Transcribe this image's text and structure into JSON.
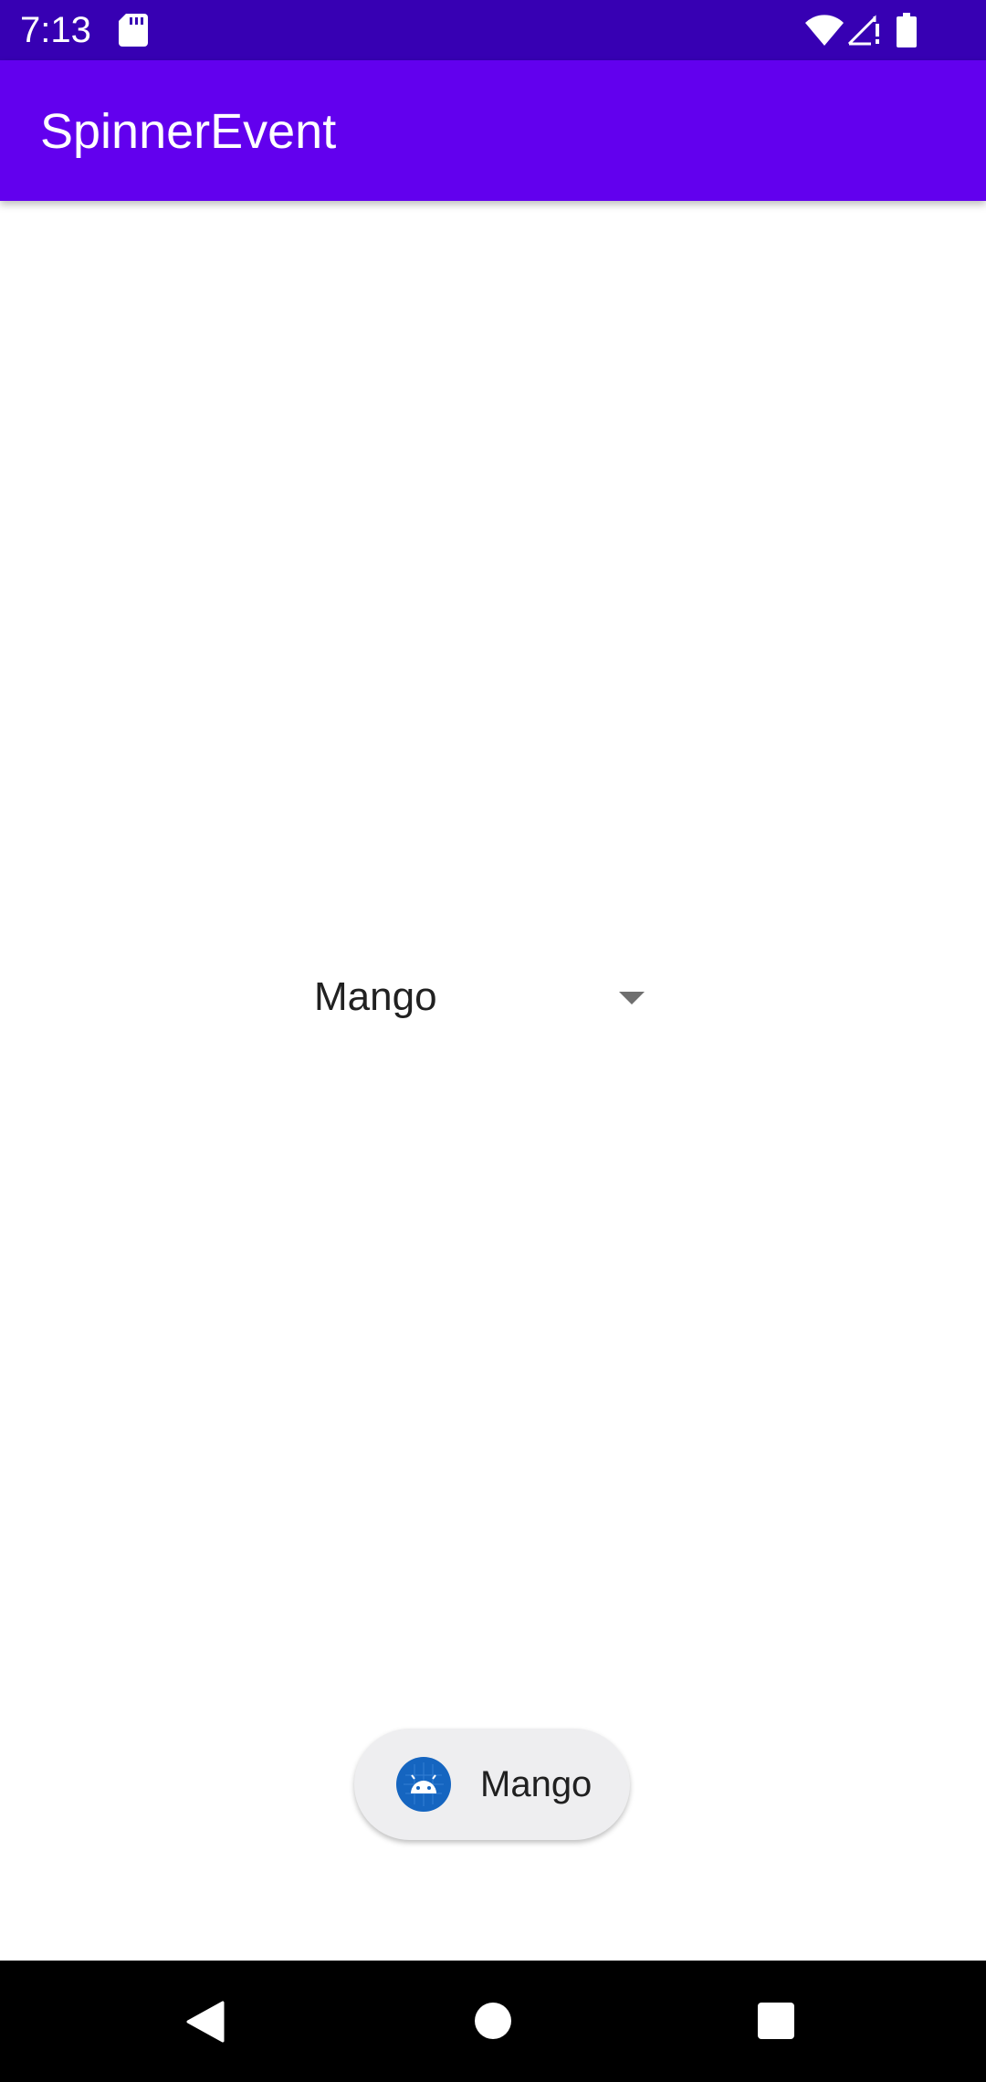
{
  "status_bar": {
    "time": "7:13",
    "icons": [
      "sd-card-icon",
      "wifi-icon",
      "cell-signal-icon",
      "battery-icon"
    ]
  },
  "app_bar": {
    "title": "SpinnerEvent"
  },
  "spinner": {
    "selected_value": "Mango",
    "icon": "dropdown-arrow-icon"
  },
  "toast": {
    "icon": "android-app-icon",
    "text": "Mango"
  },
  "nav_bar": {
    "icons": [
      "back-icon",
      "home-icon",
      "recents-icon"
    ]
  },
  "colors": {
    "status_bar": "#3700b3",
    "app_bar": "#6200ee",
    "toast_background": "#eeeef0",
    "toast_icon": "#1565c0"
  }
}
